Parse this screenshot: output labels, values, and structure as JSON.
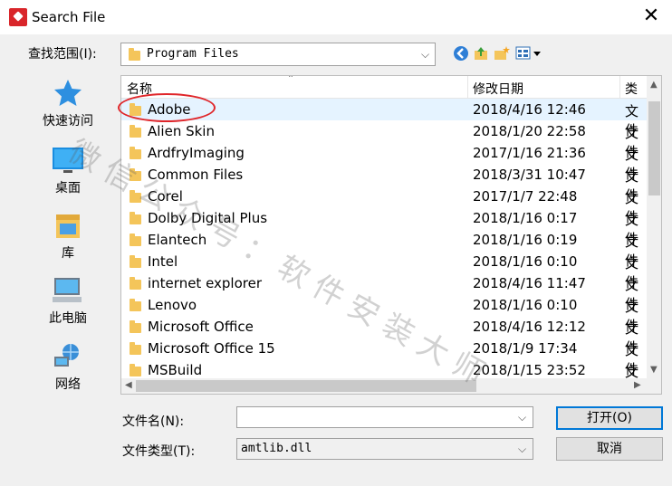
{
  "window": {
    "title": "Search File",
    "close_glyph": "✕"
  },
  "look_in": {
    "label": "查找范围(I):",
    "value": "Program Files"
  },
  "toolbar": {
    "icons": [
      "back-icon",
      "up-folder-icon",
      "new-folder-icon",
      "view-menu-icon"
    ]
  },
  "places": [
    {
      "label": "快速访问",
      "icon": "star-icon"
    },
    {
      "label": "桌面",
      "icon": "desktop-icon"
    },
    {
      "label": "库",
      "icon": "library-icon"
    },
    {
      "label": "此电脑",
      "icon": "computer-icon"
    },
    {
      "label": "网络",
      "icon": "network-icon"
    }
  ],
  "file_list": {
    "columns": [
      "名称",
      "修改日期",
      "类型"
    ],
    "rows": [
      {
        "name": "Adobe",
        "date": "2018/4/16 12:46",
        "type": "文件",
        "selected": true
      },
      {
        "name": "Alien Skin",
        "date": "2018/1/20 22:58",
        "type": "文件"
      },
      {
        "name": "ArdfryImaging",
        "date": "2017/1/16 21:36",
        "type": "文件"
      },
      {
        "name": "Common Files",
        "date": "2018/3/31 10:47",
        "type": "文件"
      },
      {
        "name": "Corel",
        "date": "2017/1/7 22:48",
        "type": "文件"
      },
      {
        "name": "Dolby Digital Plus",
        "date": "2018/1/16 0:17",
        "type": "文件"
      },
      {
        "name": "Elantech",
        "date": "2018/1/16 0:19",
        "type": "文件"
      },
      {
        "name": "Intel",
        "date": "2018/1/16 0:10",
        "type": "文件"
      },
      {
        "name": "internet explorer",
        "date": "2018/4/16 11:47",
        "type": "文件"
      },
      {
        "name": "Lenovo",
        "date": "2018/1/16 0:10",
        "type": "文件"
      },
      {
        "name": "Microsoft Office",
        "date": "2018/4/16 12:12",
        "type": "文件"
      },
      {
        "name": "Microsoft Office 15",
        "date": "2018/1/9 17:34",
        "type": "文件"
      },
      {
        "name": "MSBuild",
        "date": "2018/1/15 23:52",
        "type": "文件"
      }
    ]
  },
  "file_name": {
    "label": "文件名(N):",
    "value": ""
  },
  "file_type": {
    "label": "文件类型(T):",
    "value": "amtlib.dll"
  },
  "buttons": {
    "open": "打开(O)",
    "cancel": "取消"
  },
  "watermark": "微信公众号：软件安装大师",
  "colors": {
    "selection": "#e5f3ff",
    "highlight_circle": "#e0262a",
    "accent": "#0078d7"
  }
}
